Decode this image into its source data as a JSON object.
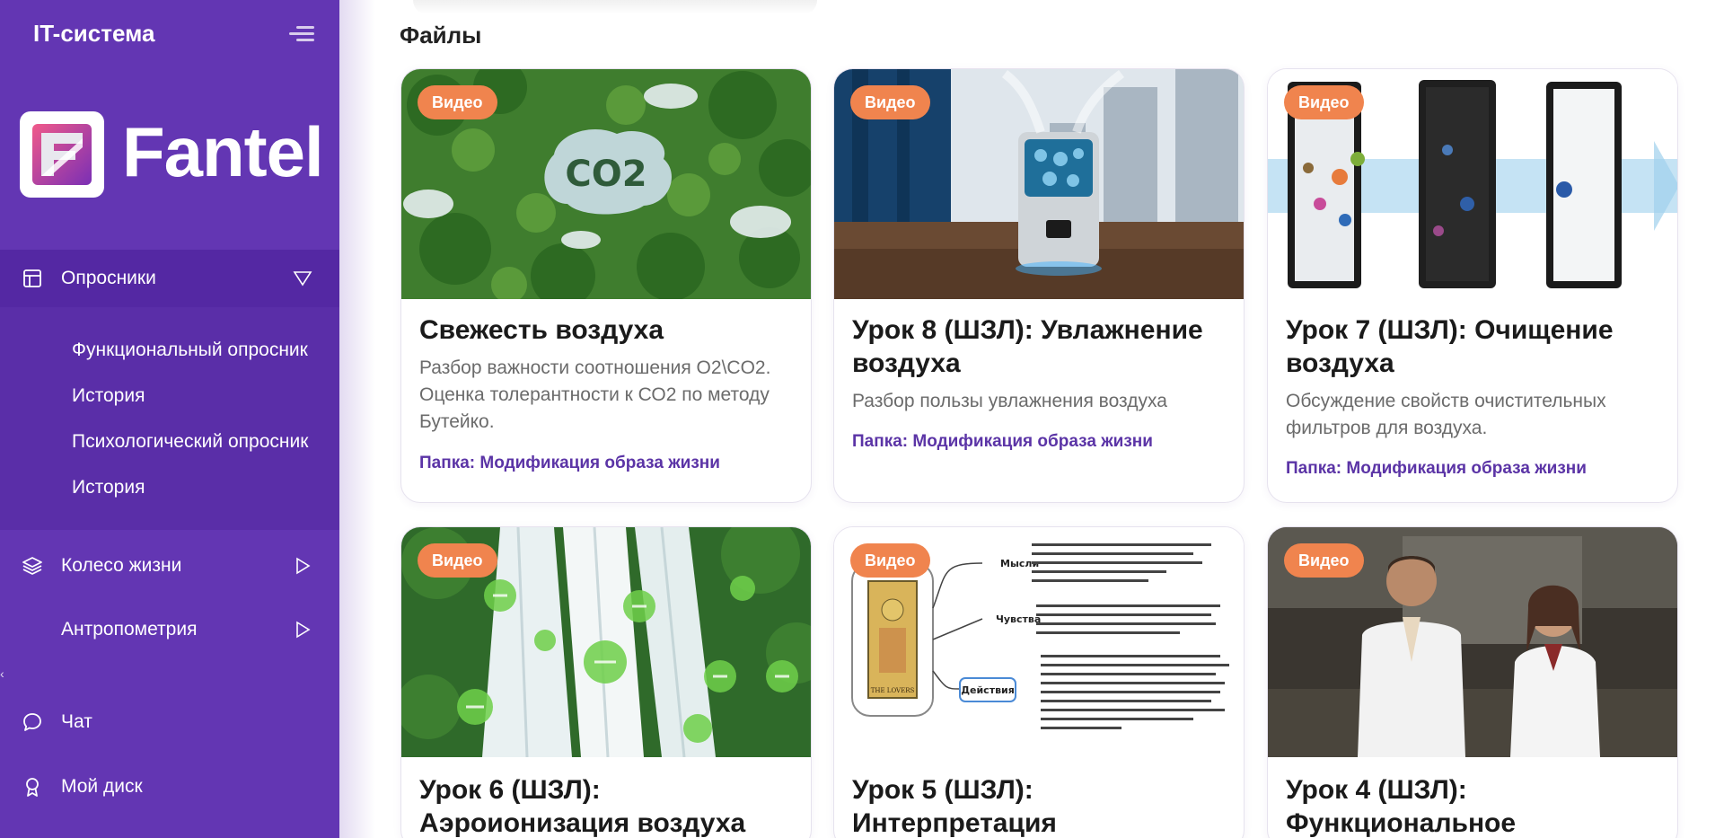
{
  "app": {
    "title": "IT-система",
    "logo_text": "Fantel"
  },
  "sidebar": {
    "items": [
      {
        "label": "Опросники",
        "expanded": true,
        "sub": [
          "Функциональный опросник",
          "История",
          "Психологический опросник",
          "История"
        ]
      },
      {
        "label": "Колесо жизни"
      },
      {
        "label": "Антропометрия"
      },
      {
        "label": "Чат"
      },
      {
        "label": "Мой диск"
      }
    ],
    "collapse_glyph": "‹"
  },
  "main": {
    "title": "Файлы",
    "cards": [
      {
        "badge": "Видео",
        "title": "Свежесть воздуха",
        "desc": "Разбор важности соотношения O2\\CO2. Оценка толерантности к СО2 по методу Бутейко.",
        "folder": "Папка: Модификация образа жизни"
      },
      {
        "badge": "Видео",
        "title": "Урок 8 (ШЗЛ): Увлажнение воздуха",
        "desc": "Разбор пользы увлажнения воздуха",
        "folder": "Папка: Модификация образа жизни"
      },
      {
        "badge": "Видео",
        "title": "Урок 7 (ШЗЛ): Очищение воздуха",
        "desc": "Обсуждение свойств очистительных фильтров для воздуха.",
        "folder": "Папка: Модификация образа жизни"
      },
      {
        "badge": "Видео",
        "title": "Урок 6 (ШЗЛ): Аэроионизация воздуха"
      },
      {
        "badge": "Видео",
        "title": "Урок 5 (ШЗЛ): Интерпретация"
      },
      {
        "badge": "Видео",
        "title": "Урок 4 (ШЗЛ): Функциональное"
      }
    ],
    "thumb_text": {
      "co2": "CO2",
      "diagram_nodes": [
        "Мысли",
        "Чувства",
        "Действия"
      ],
      "tarot": "THE LOVERS"
    }
  },
  "colors": {
    "sidebar": "#6336b3",
    "badge": "#f0844e",
    "folder_link": "#5b34a6"
  }
}
